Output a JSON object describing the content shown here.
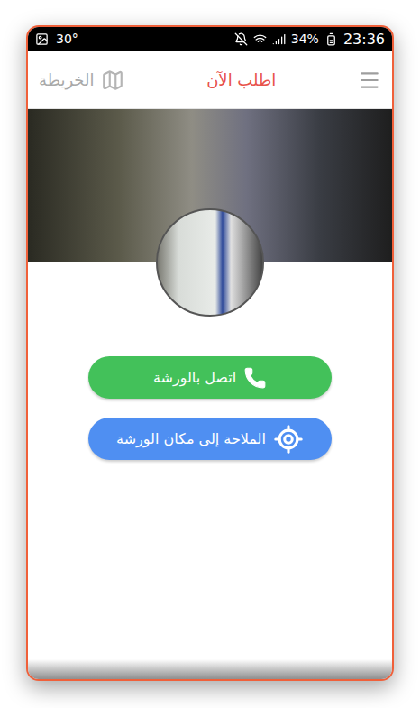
{
  "status_bar": {
    "temperature": "30°",
    "battery": "34%",
    "time": "23:36"
  },
  "app_bar": {
    "title": "اطلب الآن",
    "map_link": "الخريطة"
  },
  "buttons": [
    {
      "label": "اتصل بالورشة",
      "kind": "call",
      "color": "#43c15a"
    },
    {
      "label": "الملاحة إلى مكان الورشة",
      "kind": "navigate",
      "color": "#4f8ff2"
    }
  ]
}
